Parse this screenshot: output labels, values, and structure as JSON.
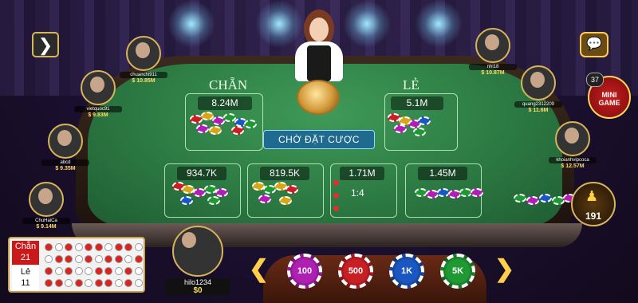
{
  "game": {
    "wait_status": "CHỜ ĐẶT CƯỢC"
  },
  "bet_areas": {
    "chan": {
      "label": "CHẴN",
      "amount": "8.24M"
    },
    "le": {
      "label": "LẺ",
      "amount": "5.1M"
    },
    "side": [
      {
        "amount": "934.7K"
      },
      {
        "amount": "819.5K"
      },
      {
        "amount": "1.71M",
        "ratio": "1:4"
      },
      {
        "amount": "1.45M"
      }
    ]
  },
  "players": [
    {
      "name": "chuanchi911",
      "money": "$ 10.85M"
    },
    {
      "name": "vietquoc91",
      "money": "$ 9.83M"
    },
    {
      "name": "abcd",
      "money": "$ 9.35M"
    },
    {
      "name": "ChuHaiCa",
      "money": "$ 9.14M"
    },
    {
      "name": "nhi18",
      "money": "$ 10.87M"
    },
    {
      "name": "quang2312209",
      "money": "$ 11.6M"
    },
    {
      "name": "khoianhvipcoca",
      "money": "$ 12.57M"
    }
  ],
  "self": {
    "name": "hilo1234",
    "money": "$0"
  },
  "history": {
    "chan_label": "Chẵn",
    "chan_count": "21",
    "le_label": "Lẻ",
    "le_count": "11"
  },
  "mini_game": {
    "count": "37",
    "label_line1": "MINI",
    "label_line2": "GAME"
  },
  "online_count": "191",
  "bet_chips": [
    {
      "value": "100",
      "color": "#b01fb4"
    },
    {
      "value": "500",
      "color": "#c81f25"
    },
    {
      "value": "1K",
      "color": "#1b57c2"
    },
    {
      "value": "5K",
      "color": "#1f9a33"
    }
  ],
  "icons": {
    "menu": "arrow-right-icon",
    "chat": "chat-icon",
    "players": "people-icon"
  }
}
